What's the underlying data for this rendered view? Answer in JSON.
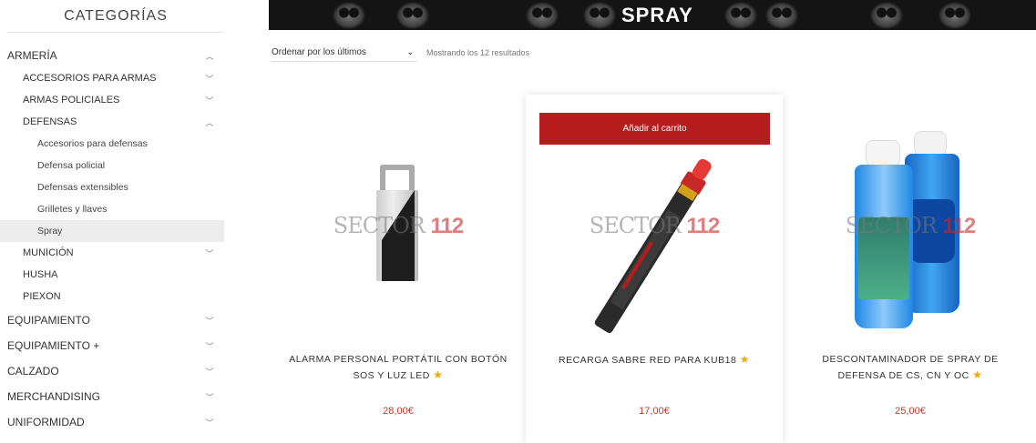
{
  "sidebar": {
    "title": "CATEGORÍAS",
    "items": [
      {
        "label": "ARMERÍA",
        "chevron": "up"
      },
      {
        "label": "ACCESORIOS PARA ARMAS",
        "chevron": "down"
      },
      {
        "label": "ARMAS POLICIALES",
        "chevron": "down"
      },
      {
        "label": "DEFENSAS",
        "chevron": "up"
      },
      {
        "label": "Accesorios para defensas"
      },
      {
        "label": "Defensa policial"
      },
      {
        "label": "Defensas extensibles"
      },
      {
        "label": "Grilletes y llaves"
      },
      {
        "label": "Spray",
        "active": true
      },
      {
        "label": "MUNICIÓN",
        "chevron": "down"
      },
      {
        "label": "HUSHA"
      },
      {
        "label": "PIEXON"
      },
      {
        "label": "EQUIPAMIENTO",
        "chevron": "down"
      },
      {
        "label": "EQUIPAMIENTO +",
        "chevron": "down"
      },
      {
        "label": "CALZADO",
        "chevron": "down"
      },
      {
        "label": "MERCHANDISING",
        "chevron": "down"
      },
      {
        "label": "UNIFORMIDAD",
        "chevron": "down"
      }
    ]
  },
  "banner": {
    "title": "SPRAY"
  },
  "toolbar": {
    "order_value": "Ordenar por los últimos",
    "results_text": "Mostrando los 12 resultados"
  },
  "watermark": {
    "left": "SECTOR",
    "right": "112"
  },
  "products": [
    {
      "name": "ALARMA PERSONAL PORTÁTIL CON BOTÓN SOS Y LUZ LED",
      "price": "28,00€"
    },
    {
      "name": "RECARGA SABRE RED PARA KUB18",
      "price": "17,00€",
      "add_to_cart": "Añadir al carrito"
    },
    {
      "name": "DESCONTAMINADOR DE SPRAY DE DEFENSA DE CS, CN Y OC",
      "price": "25,00€"
    }
  ],
  "colors": {
    "accent": "#b71c1c",
    "price": "#c0392b",
    "star": "#f0a800"
  },
  "icons": {
    "chevron_up": "^",
    "chevron_down": "⌄",
    "star": "★"
  }
}
